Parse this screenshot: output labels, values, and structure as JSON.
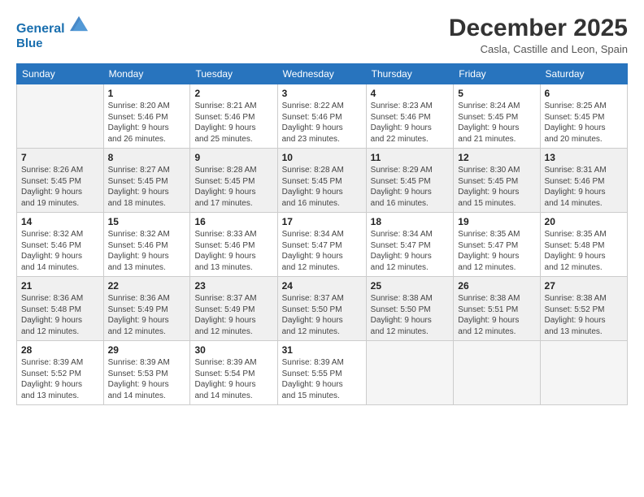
{
  "logo": {
    "line1": "General",
    "line2": "Blue"
  },
  "title": "December 2025",
  "location": "Casla, Castille and Leon, Spain",
  "weekdays": [
    "Sunday",
    "Monday",
    "Tuesday",
    "Wednesday",
    "Thursday",
    "Friday",
    "Saturday"
  ],
  "weeks": [
    [
      {
        "day": "",
        "info": ""
      },
      {
        "day": "1",
        "info": "Sunrise: 8:20 AM\nSunset: 5:46 PM\nDaylight: 9 hours\nand 26 minutes."
      },
      {
        "day": "2",
        "info": "Sunrise: 8:21 AM\nSunset: 5:46 PM\nDaylight: 9 hours\nand 25 minutes."
      },
      {
        "day": "3",
        "info": "Sunrise: 8:22 AM\nSunset: 5:46 PM\nDaylight: 9 hours\nand 23 minutes."
      },
      {
        "day": "4",
        "info": "Sunrise: 8:23 AM\nSunset: 5:46 PM\nDaylight: 9 hours\nand 22 minutes."
      },
      {
        "day": "5",
        "info": "Sunrise: 8:24 AM\nSunset: 5:45 PM\nDaylight: 9 hours\nand 21 minutes."
      },
      {
        "day": "6",
        "info": "Sunrise: 8:25 AM\nSunset: 5:45 PM\nDaylight: 9 hours\nand 20 minutes."
      }
    ],
    [
      {
        "day": "7",
        "info": "Sunrise: 8:26 AM\nSunset: 5:45 PM\nDaylight: 9 hours\nand 19 minutes."
      },
      {
        "day": "8",
        "info": "Sunrise: 8:27 AM\nSunset: 5:45 PM\nDaylight: 9 hours\nand 18 minutes."
      },
      {
        "day": "9",
        "info": "Sunrise: 8:28 AM\nSunset: 5:45 PM\nDaylight: 9 hours\nand 17 minutes."
      },
      {
        "day": "10",
        "info": "Sunrise: 8:28 AM\nSunset: 5:45 PM\nDaylight: 9 hours\nand 16 minutes."
      },
      {
        "day": "11",
        "info": "Sunrise: 8:29 AM\nSunset: 5:45 PM\nDaylight: 9 hours\nand 16 minutes."
      },
      {
        "day": "12",
        "info": "Sunrise: 8:30 AM\nSunset: 5:45 PM\nDaylight: 9 hours\nand 15 minutes."
      },
      {
        "day": "13",
        "info": "Sunrise: 8:31 AM\nSunset: 5:46 PM\nDaylight: 9 hours\nand 14 minutes."
      }
    ],
    [
      {
        "day": "14",
        "info": "Sunrise: 8:32 AM\nSunset: 5:46 PM\nDaylight: 9 hours\nand 14 minutes."
      },
      {
        "day": "15",
        "info": "Sunrise: 8:32 AM\nSunset: 5:46 PM\nDaylight: 9 hours\nand 13 minutes."
      },
      {
        "day": "16",
        "info": "Sunrise: 8:33 AM\nSunset: 5:46 PM\nDaylight: 9 hours\nand 13 minutes."
      },
      {
        "day": "17",
        "info": "Sunrise: 8:34 AM\nSunset: 5:47 PM\nDaylight: 9 hours\nand 12 minutes."
      },
      {
        "day": "18",
        "info": "Sunrise: 8:34 AM\nSunset: 5:47 PM\nDaylight: 9 hours\nand 12 minutes."
      },
      {
        "day": "19",
        "info": "Sunrise: 8:35 AM\nSunset: 5:47 PM\nDaylight: 9 hours\nand 12 minutes."
      },
      {
        "day": "20",
        "info": "Sunrise: 8:35 AM\nSunset: 5:48 PM\nDaylight: 9 hours\nand 12 minutes."
      }
    ],
    [
      {
        "day": "21",
        "info": "Sunrise: 8:36 AM\nSunset: 5:48 PM\nDaylight: 9 hours\nand 12 minutes."
      },
      {
        "day": "22",
        "info": "Sunrise: 8:36 AM\nSunset: 5:49 PM\nDaylight: 9 hours\nand 12 minutes."
      },
      {
        "day": "23",
        "info": "Sunrise: 8:37 AM\nSunset: 5:49 PM\nDaylight: 9 hours\nand 12 minutes."
      },
      {
        "day": "24",
        "info": "Sunrise: 8:37 AM\nSunset: 5:50 PM\nDaylight: 9 hours\nand 12 minutes."
      },
      {
        "day": "25",
        "info": "Sunrise: 8:38 AM\nSunset: 5:50 PM\nDaylight: 9 hours\nand 12 minutes."
      },
      {
        "day": "26",
        "info": "Sunrise: 8:38 AM\nSunset: 5:51 PM\nDaylight: 9 hours\nand 12 minutes."
      },
      {
        "day": "27",
        "info": "Sunrise: 8:38 AM\nSunset: 5:52 PM\nDaylight: 9 hours\nand 13 minutes."
      }
    ],
    [
      {
        "day": "28",
        "info": "Sunrise: 8:39 AM\nSunset: 5:52 PM\nDaylight: 9 hours\nand 13 minutes."
      },
      {
        "day": "29",
        "info": "Sunrise: 8:39 AM\nSunset: 5:53 PM\nDaylight: 9 hours\nand 14 minutes."
      },
      {
        "day": "30",
        "info": "Sunrise: 8:39 AM\nSunset: 5:54 PM\nDaylight: 9 hours\nand 14 minutes."
      },
      {
        "day": "31",
        "info": "Sunrise: 8:39 AM\nSunset: 5:55 PM\nDaylight: 9 hours\nand 15 minutes."
      },
      {
        "day": "",
        "info": ""
      },
      {
        "day": "",
        "info": ""
      },
      {
        "day": "",
        "info": ""
      }
    ]
  ]
}
